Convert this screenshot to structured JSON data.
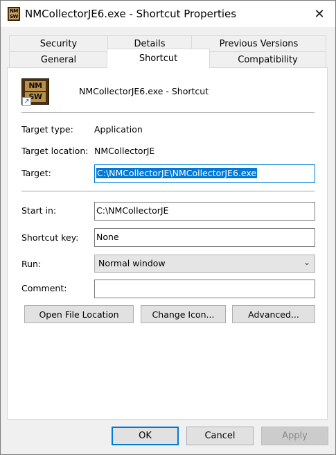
{
  "window": {
    "title": "NMCollectorJE6.exe - Shortcut Properties",
    "close_glyph": "✕",
    "icon_text_top": "NM",
    "icon_text_bottom": "SW"
  },
  "tabs": {
    "back_row": [
      "Security",
      "Details",
      "Previous Versions"
    ],
    "front_row": [
      "General",
      "Shortcut",
      "Compatibility"
    ],
    "active": "Shortcut"
  },
  "shortcut": {
    "name": "NMCollectorJE6.exe - Shortcut",
    "target_type_label": "Target type:",
    "target_type_value": "Application",
    "target_location_label": "Target location:",
    "target_location_value": "NMCollectorJE",
    "target_label": "Target:",
    "target_value": "C:\\NMCollectorJE\\NMCollectorJE6.exe",
    "start_in_label": "Start in:",
    "start_in_value": "C:\\NMCollectorJE",
    "shortcut_key_label": "Shortcut key:",
    "shortcut_key_value": "None",
    "run_label": "Run:",
    "run_value": "Normal window",
    "comment_label": "Comment:",
    "comment_value": ""
  },
  "buttons": {
    "open_file_location": "Open File Location",
    "change_icon": "Change Icon...",
    "advanced": "Advanced..."
  },
  "dialog_buttons": {
    "ok": "OK",
    "cancel": "Cancel",
    "apply": "Apply"
  },
  "colors": {
    "accent": "#0078d7",
    "panel_bg": "#ffffff",
    "window_bg": "#f0f0f0"
  }
}
